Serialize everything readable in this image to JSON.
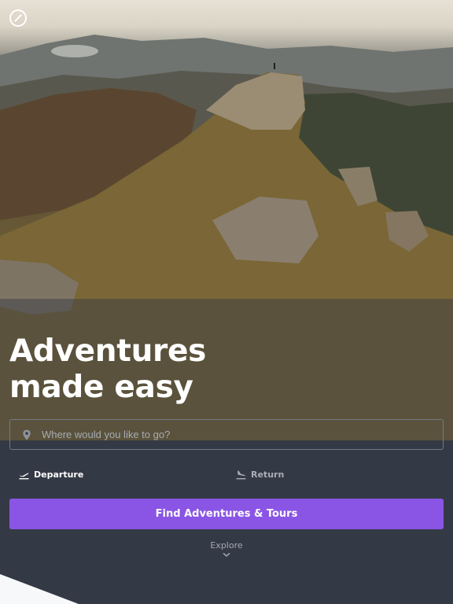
{
  "brand": {
    "logo_icon": "compass-logo-icon"
  },
  "hero": {
    "title_line1": "Adventures",
    "title_line2": "made easy"
  },
  "search": {
    "icon": "map-pin-icon",
    "placeholder": "Where would you like to go?",
    "value": ""
  },
  "dates": {
    "departure_label": "Departure",
    "departure_icon": "plane-takeoff-icon",
    "return_label": "Return",
    "return_icon": "plane-landing-icon"
  },
  "cta": {
    "label": "Find Adventures & Tours",
    "color": "#8a55e4"
  },
  "explore": {
    "label": "Explore",
    "icon": "chevron-down-icon"
  },
  "colors": {
    "panel": "#343a45",
    "accent": "#8a55e4"
  }
}
